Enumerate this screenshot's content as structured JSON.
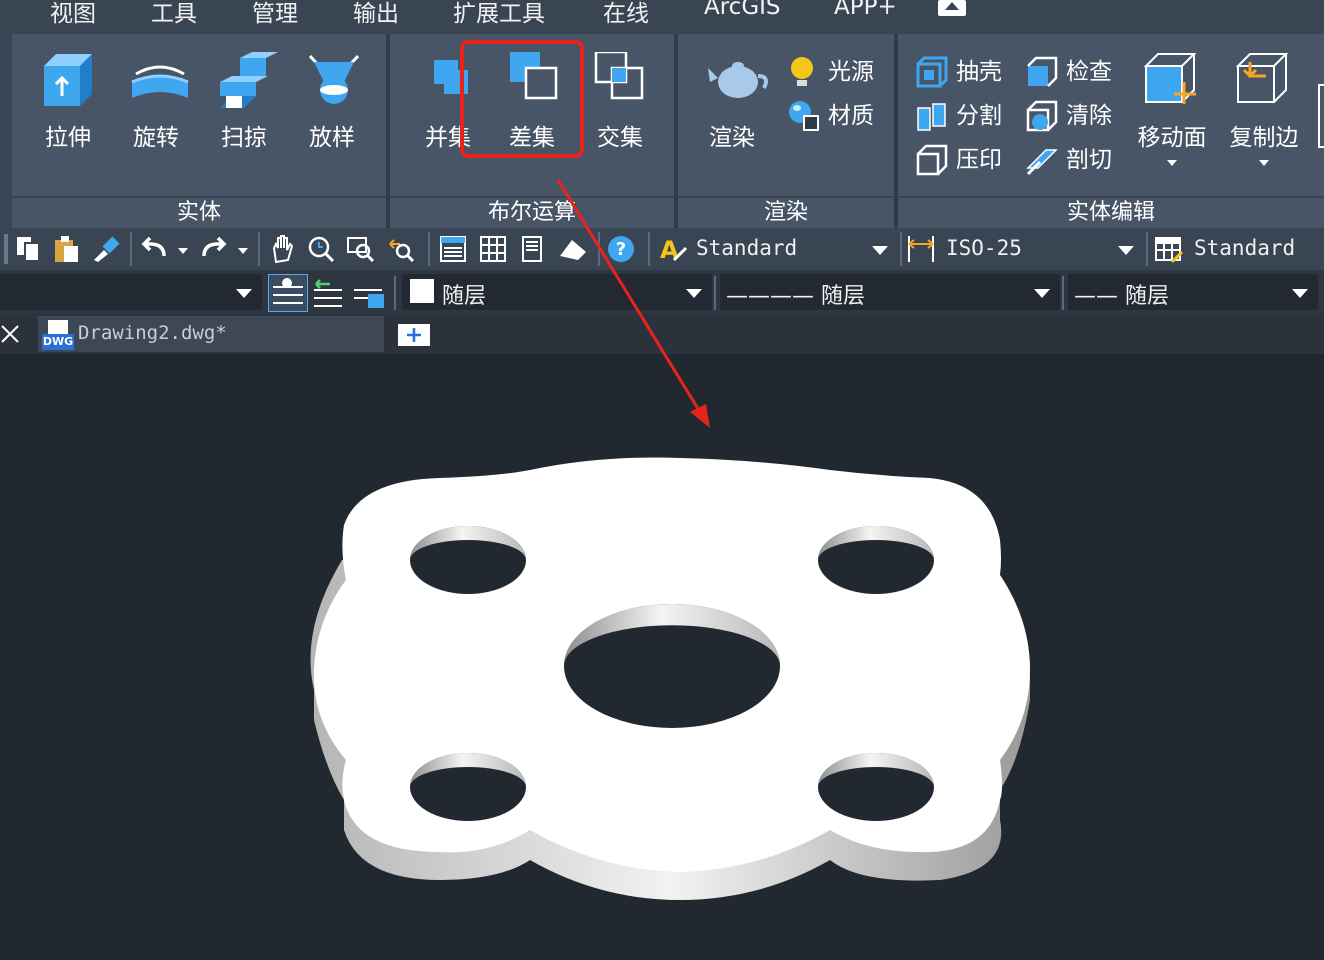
{
  "menu": {
    "items": [
      "视图",
      "工具",
      "管理",
      "输出",
      "扩展工具",
      "在线",
      "ArcGIS",
      "APP+"
    ]
  },
  "ribbon": {
    "solid": {
      "title": "实体",
      "buttons": {
        "extrude": "拉伸",
        "revolve": "旋转",
        "sweep": "扫掠",
        "loft": "放样"
      }
    },
    "boolean": {
      "title": "布尔运算",
      "buttons": {
        "union": "并集",
        "subtract": "差集",
        "intersect": "交集"
      }
    },
    "render": {
      "title": "渲染",
      "buttons": {
        "render": "渲染",
        "light": "光源",
        "material": "材质"
      }
    },
    "solid_edit": {
      "title": "实体编辑",
      "buttons": {
        "shell": "抽壳",
        "check": "检查",
        "separate": "分割",
        "clean": "清除",
        "imprint": "压印",
        "slice": "剖切",
        "move_face": "移动面",
        "copy_edge": "复制边"
      }
    }
  },
  "toolbar": {
    "text_style": "Standard",
    "dim_style": "ISO-25",
    "table_style": "Standard"
  },
  "properties": {
    "color": "随层",
    "linetype": "———— 随层",
    "lineweight": "—— 随层"
  },
  "tabs": {
    "doc_name": "Drawing2.dwg*",
    "dwg_badge": "DWG"
  },
  "colors": {
    "highlight_box": "#e8231c",
    "annotation_arrow": "#e8231c",
    "icon_blue": "#3fa6f0",
    "ribbon_panel": "#485567"
  }
}
